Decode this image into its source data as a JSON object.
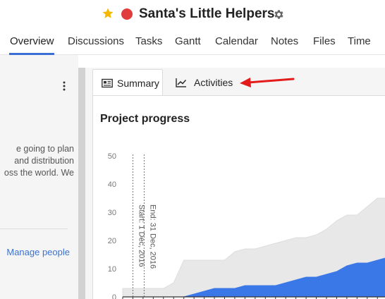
{
  "header": {
    "title": "Santa's Little Helpers",
    "icons": [
      "star-icon",
      "status-dot-icon",
      "gear-icon"
    ],
    "colors": {
      "star": "#f5b800",
      "status_dot": "#e03d3d"
    }
  },
  "nav": {
    "items": [
      {
        "label": "Overview",
        "active": true
      },
      {
        "label": "Discussions"
      },
      {
        "label": "Tasks"
      },
      {
        "label": "Gantt"
      },
      {
        "label": "Calendar"
      },
      {
        "label": "Notes"
      },
      {
        "label": "Files"
      },
      {
        "label": "Time"
      }
    ],
    "accent": "#3b6fd6"
  },
  "left_panel": {
    "description_lines": [
      "e going to plan",
      "and distribution",
      "oss the world. We"
    ],
    "manage_link": "Manage people",
    "link_color": "#3b73d0"
  },
  "tabs": {
    "summary": "Summary",
    "activities": "Activities"
  },
  "card": {
    "title": "Project progress"
  },
  "chart_data": {
    "type": "area",
    "yticks": [
      "0",
      "10",
      "20",
      "30",
      "40",
      "50"
    ],
    "ylim": [
      0,
      50
    ],
    "grid": false,
    "annotations": [
      "Start: 1 Dec, 2016",
      "End: 31 Dec, 2016"
    ],
    "x": [
      1,
      2,
      3,
      4,
      5,
      6,
      7,
      8,
      9,
      10,
      11,
      12,
      13,
      14,
      15,
      16,
      17,
      18,
      19,
      20,
      21,
      22,
      23,
      24,
      25,
      26,
      27,
      28,
      29,
      30,
      31
    ],
    "series": [
      {
        "color": "#e8e8e8",
        "values": [
          3,
          3,
          3,
          3,
          3,
          5,
          13,
          13,
          13,
          13,
          13,
          16,
          17,
          17,
          18,
          19,
          20,
          21,
          21,
          22,
          24,
          27,
          29,
          29,
          32,
          35,
          35,
          35,
          35,
          36,
          37
        ]
      },
      {
        "color": "#3b78e7",
        "values": [
          0,
          0,
          0,
          0,
          0,
          0,
          0,
          1,
          2,
          3,
          3,
          3,
          4,
          4,
          4,
          4,
          5,
          6,
          7,
          7,
          8,
          9,
          11,
          12,
          12,
          13,
          14,
          15,
          16,
          17,
          17
        ]
      }
    ]
  }
}
